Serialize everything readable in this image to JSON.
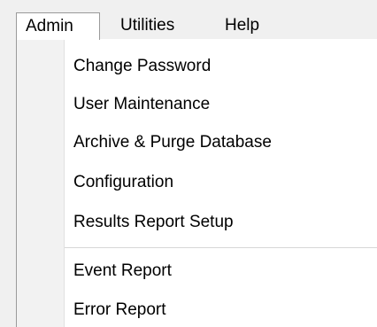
{
  "menubar": {
    "items": [
      {
        "label": "Admin"
      },
      {
        "label": "Utilities"
      },
      {
        "label": "Help"
      }
    ]
  },
  "dropdown": {
    "items": [
      {
        "label": "Change Password"
      },
      {
        "label": "User Maintenance"
      },
      {
        "label": "Archive & Purge Database"
      },
      {
        "label": "Configuration"
      },
      {
        "label": "Results Report Setup"
      },
      {
        "label": "Event Report"
      },
      {
        "label": "Error Report"
      }
    ]
  }
}
